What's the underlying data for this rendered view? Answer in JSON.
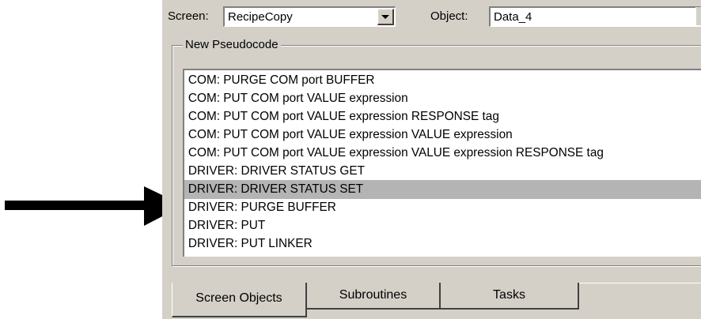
{
  "screen": {
    "label": "Screen:",
    "value": "RecipeCopy"
  },
  "object": {
    "label": "Object:",
    "value": "Data_4"
  },
  "group": {
    "title": "New Pseudocode"
  },
  "pseudocode_list": {
    "items": [
      "COM: PURGE COM port BUFFER",
      "COM: PUT COM port VALUE expression",
      "COM: PUT COM port VALUE expression RESPONSE tag",
      "COM: PUT COM port VALUE expression VALUE expression",
      "COM: PUT COM port VALUE expression VALUE expression RESPONSE tag",
      "DRIVER: DRIVER STATUS GET",
      "DRIVER: DRIVER STATUS SET",
      "DRIVER: PURGE BUFFER",
      "DRIVER: PUT",
      "DRIVER: PUT LINKER"
    ],
    "selected_index": 6
  },
  "tabs": [
    {
      "label": "Screen Objects",
      "active": true
    },
    {
      "label": "Subroutines",
      "active": false
    },
    {
      "label": "Tasks",
      "active": false
    }
  ],
  "icons": {
    "arrow": "right-arrow-icon",
    "dropdown": "chevron-down-icon"
  },
  "colors": {
    "panel": "#d4d0c8",
    "selection": "#b4b4b4",
    "arrow": "#000000"
  }
}
